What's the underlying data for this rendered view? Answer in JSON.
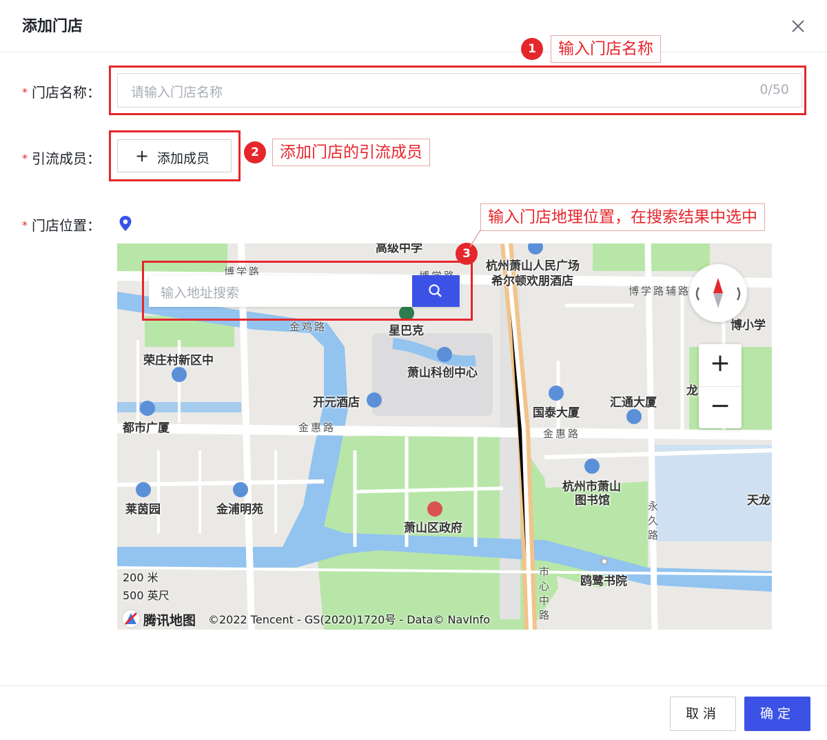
{
  "dialog": {
    "title": "添加门店"
  },
  "form": {
    "store_name": {
      "label": "门店名称：",
      "placeholder": "请输入门店名称",
      "counter": "0/50"
    },
    "members": {
      "label": "引流成员：",
      "button_label": "添加成员"
    },
    "location": {
      "label": "门店位置："
    }
  },
  "required_mark": "*",
  "annotations": [
    {
      "number": "1",
      "text": "输入门店名称"
    },
    {
      "number": "2",
      "text": "添加门店的引流成员"
    },
    {
      "number": "3",
      "text": "输入门店地理位置，在搜索结果中选中"
    }
  ],
  "map": {
    "search_placeholder": "输入地址搜索",
    "labels": {
      "gaojizhongxue": "高级中学",
      "hotel": "杭州萧山人民广场",
      "hotel2": "希尔顿欢朋酒店",
      "starbucks": "星巴克",
      "rongzhuang": "荣庄村新区中",
      "chuangxin": "萧山科创中心",
      "kaiyuan": "开元酒店",
      "dushi": "都市广厦",
      "guotai": "国泰大厦",
      "huitong": "汇通大厦",
      "long": "龙",
      "xiaoxue": "博小学",
      "laiyin": "莱茵园",
      "jinpu": "金浦明苑",
      "library1": "杭州市萧山",
      "library2": "图书馆",
      "zhengfu": "萧山区政府",
      "tianlong": "天龙",
      "oulu": "鸥鹭书院"
    },
    "roads": {
      "bosue1": "博学路",
      "bosue2": "博学路",
      "bosue3": "博学路辅路",
      "jinji": "金鸡路",
      "jinhui1": "金惠路",
      "jinhui2": "金惠路",
      "yongjiu": "永久路",
      "shixinzhong": "市心中路"
    },
    "scale": {
      "metric": "200 米",
      "imperial": "500 英尺"
    },
    "logo_text": "腾讯地图",
    "attribution": "©2022 Tencent - GS(2020)1720号 - Data© NavInfo",
    "zoom_in": "+",
    "zoom_out": "−"
  },
  "footer": {
    "cancel": "取消",
    "confirm": "确定"
  },
  "colors": {
    "primary": "#3c52e6",
    "annotation_red": "#e5262b"
  }
}
